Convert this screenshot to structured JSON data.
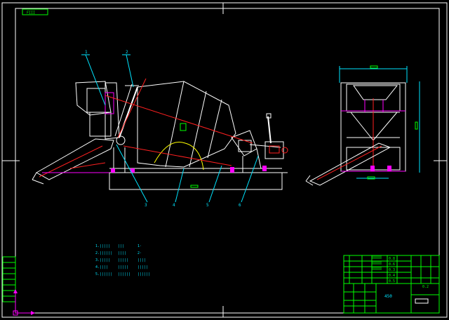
{
  "sheet": {
    "background": "#000000",
    "colors": {
      "frame": "#ffffff",
      "cyan": "#00e5ff",
      "green": "#00ff00",
      "red": "#ff2020",
      "magenta": "#ff00ff",
      "yellow": "#ffff00"
    }
  },
  "tag": "FIII",
  "leaders": [
    "1",
    "2",
    "3",
    "4",
    "5",
    "6"
  ],
  "title_block": {
    "name": "450",
    "cells": [
      "0.8",
      "0.6",
      "0.3",
      "0.4",
      "0.5",
      "0.2"
    ]
  },
  "notes": {
    "col1": [
      "1.|||||",
      "2.||||||",
      "3.|||||",
      "4.||||",
      "5.||||||"
    ],
    "col2": [
      "|||",
      "||||",
      "|||||",
      "|||||",
      "||||||"
    ],
    "col3": [
      "1·",
      "2·",
      "||||",
      "|||||",
      "||||||"
    ]
  },
  "icons": {
    "ucs": "ucs-axis-icon"
  }
}
